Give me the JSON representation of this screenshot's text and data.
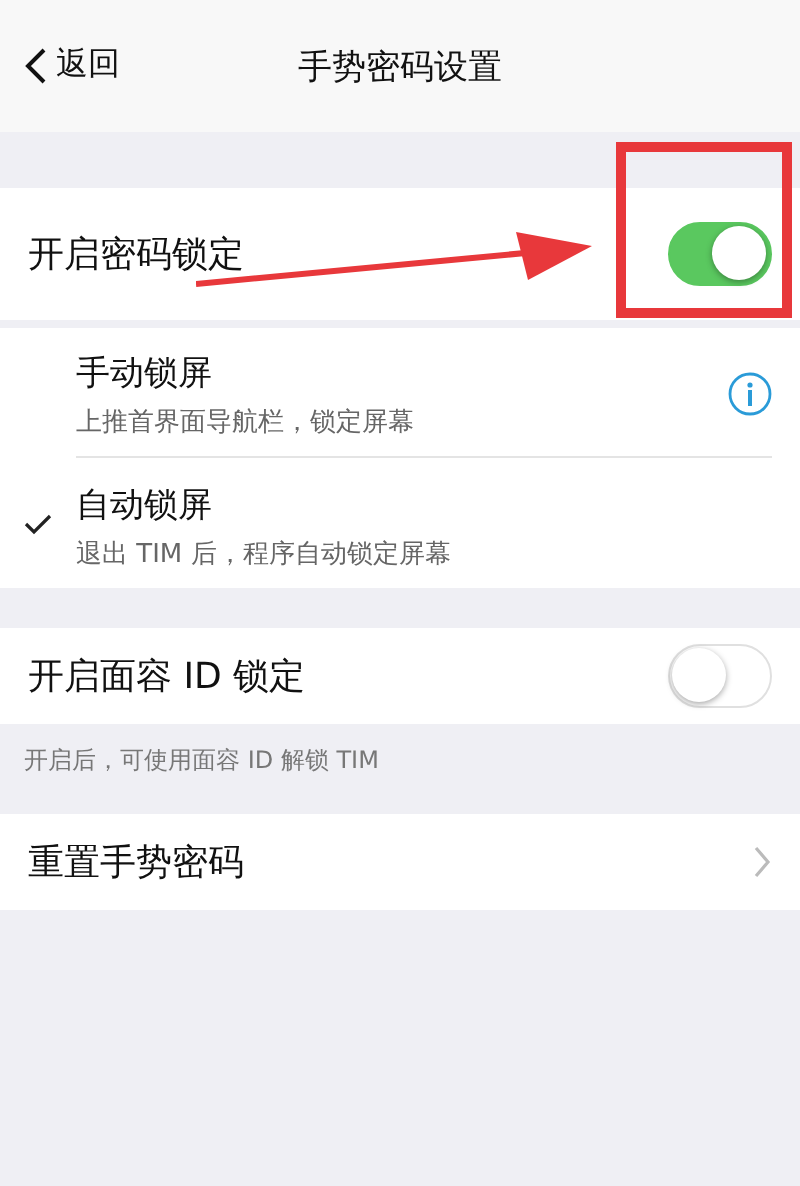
{
  "nav": {
    "back": "返回",
    "title": "手势密码设置"
  },
  "password_lock": {
    "label": "开启密码锁定",
    "on": true
  },
  "lock_modes": [
    {
      "title": "手动锁屏",
      "subtitle": "上推首界面导航栏，锁定屏幕",
      "selected": false,
      "info": true
    },
    {
      "title": "自动锁屏",
      "subtitle": "退出 TIM 后，程序自动锁定屏幕",
      "selected": true,
      "info": false
    }
  ],
  "face_id": {
    "label": "开启面容 ID 锁定",
    "on": false,
    "note": "开启后，可使用面容 ID 解锁 TIM"
  },
  "reset": {
    "label": "重置手势密码"
  },
  "annotations": {
    "highlight_frame": true,
    "pointer_arrow": true
  }
}
